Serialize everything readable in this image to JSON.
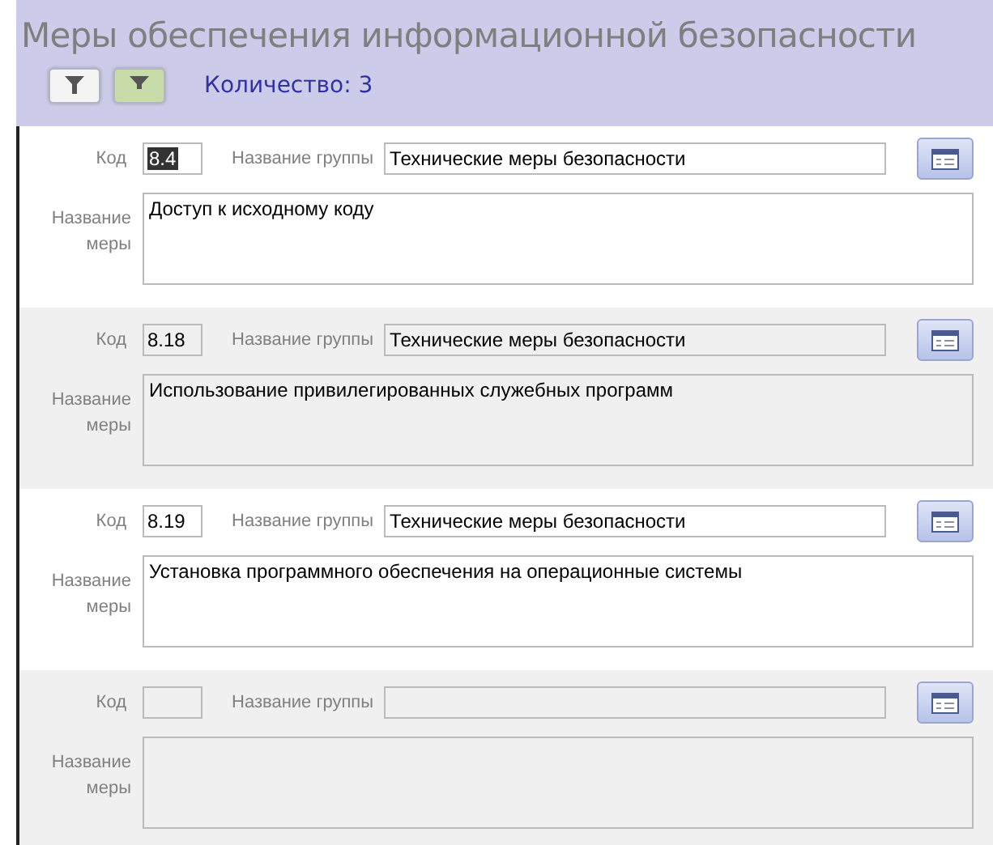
{
  "header": {
    "title": "Меры обеспечения информационной безопасности",
    "count": "Количество: 3"
  },
  "records": [
    {
      "code_label": "Код",
      "code": "8.4",
      "code_selected": true,
      "group_label": "Название группы",
      "group": "Технические меры безопасности",
      "name_label": "Название меры",
      "name": "Доступ к исходному коду"
    },
    {
      "code_label": "Код",
      "code": "8.18",
      "code_selected": false,
      "group_label": "Название группы",
      "group": "Технические меры безопасности",
      "name_label": "Название меры",
      "name": "Использование привилегированных служебных программ"
    },
    {
      "code_label": "Код",
      "code": "8.19",
      "code_selected": false,
      "group_label": "Название группы",
      "group": "Технические меры безопасности",
      "name_label": "Название меры",
      "name": "Установка программного обеспечения на операционные системы"
    },
    {
      "code_label": "Код",
      "group_label": "Название группы",
      "name_label": "Название меры"
    }
  ]
}
